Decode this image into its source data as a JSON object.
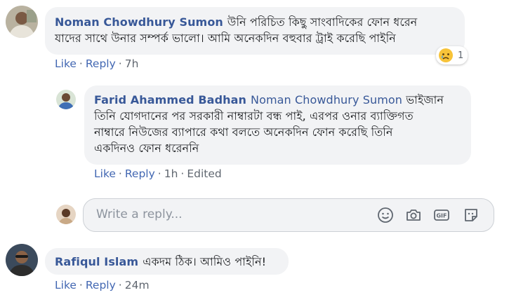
{
  "comments": [
    {
      "author": "Noman Chowdhury Sumon",
      "lines": [
        "উনি পরিচিত কিছু সাংবাদিকের ফোন ধরেন",
        "যাদের সাথে উনার সম্পর্ক ভালো। আমি অনেকদিন বহুবার ট্রাই করেছি পাইনি"
      ],
      "actions": {
        "like": "Like",
        "reply": "Reply",
        "time": "7h"
      },
      "reaction": {
        "icon": "sad-emoji-icon",
        "count": "1"
      }
    },
    {
      "author": "Farid Ahammed Badhan",
      "mention": "Noman Chowdhury Sumon",
      "lines": [
        "ভাইজান",
        "তিনি যোগদানের পর সরকারী নাম্বারটা বন্ধ পাই, এরপর ওনার ব্যাক্তিগত",
        "নাম্বারে নিউজের ব্যাপারে কথা বলতে অনেকদিন ফোন করেছি তিনি",
        "একদিনও ফোন ধরেননি"
      ],
      "actions": {
        "like": "Like",
        "reply": "Reply",
        "time": "1h",
        "edited": "Edited"
      }
    },
    {
      "author": "Rafiqul Islam",
      "lines": [
        "একদম ঠিক। আমিও পাইনি!"
      ],
      "actions": {
        "like": "Like",
        "reply": "Reply",
        "time": "24m"
      }
    }
  ],
  "reply_box": {
    "placeholder": "Write a reply...",
    "tools": [
      "emoji-icon",
      "camera-icon",
      "gif-icon",
      "sticker-icon"
    ]
  },
  "colors": {
    "link": "#385898",
    "action": "#4267b2",
    "bubble": "#f2f3f5",
    "meta": "#606770"
  }
}
